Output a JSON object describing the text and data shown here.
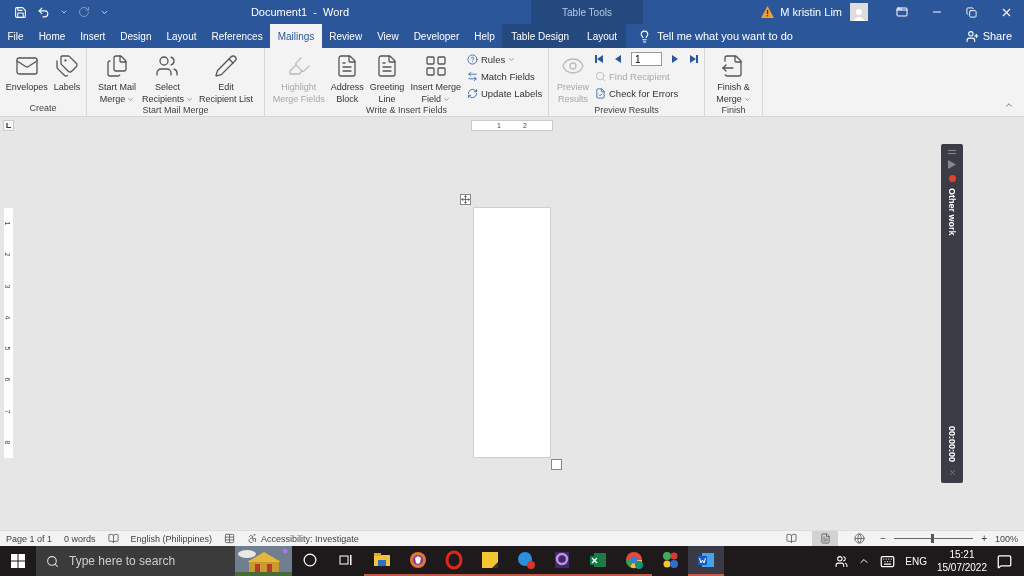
{
  "title_bar": {
    "title": "Document1  -  Word",
    "context_label": "Table Tools",
    "user_name": "M kristin Lim",
    "redo_disabled": true
  },
  "tabs": [
    {
      "label": "File",
      "selected": false,
      "kind": "standard"
    },
    {
      "label": "Home",
      "selected": false,
      "kind": "standard"
    },
    {
      "label": "Insert",
      "selected": false,
      "kind": "standard"
    },
    {
      "label": "Design",
      "selected": false,
      "kind": "standard"
    },
    {
      "label": "Layout",
      "selected": false,
      "kind": "standard"
    },
    {
      "label": "References",
      "selected": false,
      "kind": "standard"
    },
    {
      "label": "Mailings",
      "selected": true,
      "kind": "standard"
    },
    {
      "label": "Review",
      "selected": false,
      "kind": "standard"
    },
    {
      "label": "View",
      "selected": false,
      "kind": "standard"
    },
    {
      "label": "Developer",
      "selected": false,
      "kind": "standard"
    },
    {
      "label": "Help",
      "selected": false,
      "kind": "standard"
    },
    {
      "label": "Table Design",
      "selected": false,
      "kind": "contextual"
    },
    {
      "label": "Layout",
      "selected": false,
      "kind": "contextual"
    }
  ],
  "tell_me": "Tell me what you want to do",
  "share": "Share",
  "ribbon": {
    "groups": [
      {
        "label": "Create",
        "items": [
          {
            "kind": "large",
            "lines": [
              "Envelopes"
            ],
            "disabled": false,
            "dropdown": false
          },
          {
            "kind": "large",
            "lines": [
              "Labels"
            ],
            "disabled": false,
            "dropdown": false
          }
        ]
      },
      {
        "label": "Start Mail Merge",
        "items": [
          {
            "kind": "large",
            "lines": [
              "Start Mail",
              "Merge"
            ],
            "disabled": false,
            "dropdown": true
          },
          {
            "kind": "large",
            "lines": [
              "Select",
              "Recipients"
            ],
            "disabled": false,
            "dropdown": true
          },
          {
            "kind": "large",
            "lines": [
              "Edit",
              "Recipient List"
            ],
            "disabled": false,
            "dropdown": false
          }
        ]
      },
      {
        "label": "Write & Insert Fields",
        "items": [
          {
            "kind": "large",
            "lines": [
              "Highlight",
              "Merge Fields"
            ],
            "disabled": true,
            "dropdown": false
          },
          {
            "kind": "large",
            "lines": [
              "Address",
              "Block"
            ],
            "disabled": false,
            "dropdown": false
          },
          {
            "kind": "large",
            "lines": [
              "Greeting",
              "Line"
            ],
            "disabled": false,
            "dropdown": false
          },
          {
            "kind": "large",
            "lines": [
              "Insert Merge",
              "Field"
            ],
            "disabled": false,
            "dropdown": true
          },
          {
            "kind": "stack",
            "children": [
              {
                "kind": "small",
                "label": "Rules",
                "disabled": false,
                "dropdown": true
              },
              {
                "kind": "small",
                "label": "Match Fields",
                "disabled": false,
                "dropdown": false
              },
              {
                "kind": "small",
                "label": "Update Labels",
                "disabled": false,
                "dropdown": false
              }
            ]
          }
        ]
      },
      {
        "label": "Preview Results",
        "items": [
          {
            "kind": "large",
            "lines": [
              "Preview",
              "Results"
            ],
            "disabled": true,
            "dropdown": false
          },
          {
            "kind": "stack",
            "children": [
              {
                "kind": "nav",
                "record": "1"
              },
              {
                "kind": "small",
                "label": "Find Recipient",
                "disabled": true,
                "dropdown": false
              },
              {
                "kind": "small",
                "label": "Check for Errors",
                "disabled": false,
                "dropdown": false
              }
            ]
          }
        ]
      },
      {
        "label": "Finish",
        "items": [
          {
            "kind": "large",
            "lines": [
              "Finish &",
              "Merge"
            ],
            "disabled": false,
            "dropdown": true
          }
        ]
      }
    ]
  },
  "rulers": {
    "horizontal": [
      "1",
      "2"
    ],
    "vertical": [
      "1",
      "2",
      "3",
      "4",
      "5",
      "6",
      "7",
      "8"
    ]
  },
  "recorder": {
    "label": "Other work",
    "timer": "00:00:00",
    "recording": true
  },
  "status_bar": {
    "items": [
      "Page 1 of 1",
      "0 words",
      "English (Philippines)",
      "Accessibility: Investigate"
    ],
    "views": [
      {
        "selected": false
      },
      {
        "selected": true
      },
      {
        "selected": false
      }
    ],
    "zoom": {
      "minus": "−",
      "plus": "+",
      "level": 0.47,
      "reading": "100%"
    }
  },
  "taskbar": {
    "search_placeholder": "Type here to search",
    "apps": [
      {
        "running": true,
        "selected": false
      },
      {
        "running": true,
        "selected": false
      },
      {
        "running": true,
        "selected": false
      },
      {
        "running": true,
        "selected": false
      },
      {
        "running": true,
        "selected": false
      },
      {
        "running": true,
        "selected": false
      },
      {
        "running": true,
        "selected": false
      },
      {
        "running": true,
        "selected": false
      },
      {
        "running": false,
        "selected": false
      },
      {
        "running": true,
        "selected": true
      }
    ],
    "language": "ENG",
    "time": "15:21",
    "date": "15/07/2022"
  }
}
